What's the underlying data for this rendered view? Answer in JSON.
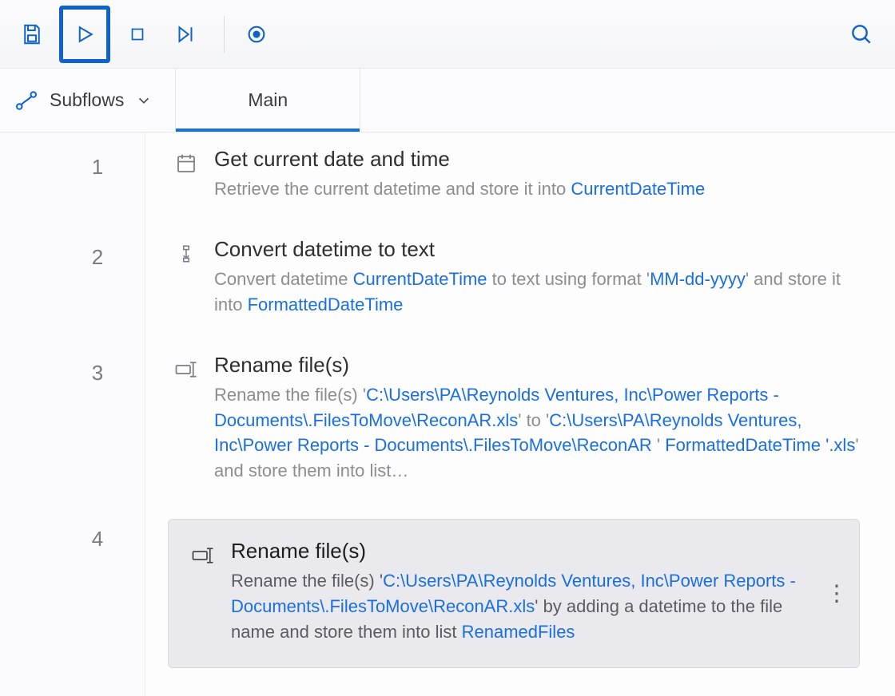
{
  "toolbar": {
    "save": "Save",
    "run": "Run",
    "stop": "Stop",
    "step": "Run next action",
    "record": "Recorder",
    "search": "Search"
  },
  "tabs": {
    "subflows_label": "Subflows",
    "main_label": "Main"
  },
  "steps": [
    {
      "num": "1",
      "title": "Get current date and time",
      "pre": "Retrieve the current datetime and store it into ",
      "var1": "CurrentDateTime"
    },
    {
      "num": "2",
      "title": "Convert datetime to text",
      "p1": "Convert datetime ",
      "v1": "CurrentDateTime",
      "p2": " to text using format '",
      "fmt": "MM-dd-yyyy",
      "p3": "' and store it into ",
      "v2": "FormattedDateTime"
    },
    {
      "num": "3",
      "title": "Rename file(s)",
      "p1": "Rename the file(s) '",
      "path1": "C:\\Users\\PA\\Reynolds Ventures, Inc\\Power Reports - Documents\\.FilesToMove\\ReconAR.xls",
      "p2": "' to '",
      "path2": "C:\\Users\\PA\\Reynolds Ventures, Inc\\Power Reports - Documents\\.FilesToMove\\ReconAR ",
      "v1": "FormattedDateTime",
      "ext": " '.xls",
      "p3": "' and store them into list…"
    },
    {
      "num": "4",
      "title": "Rename file(s)",
      "p1": "Rename the file(s) '",
      "path1": "C:\\Users\\PA\\Reynolds Ventures, Inc\\Power Reports - Documents\\.FilesToMove\\ReconAR.xls",
      "p2": "' by adding a datetime to the file name and store them into list ",
      "v1": "RenamedFiles"
    }
  ]
}
